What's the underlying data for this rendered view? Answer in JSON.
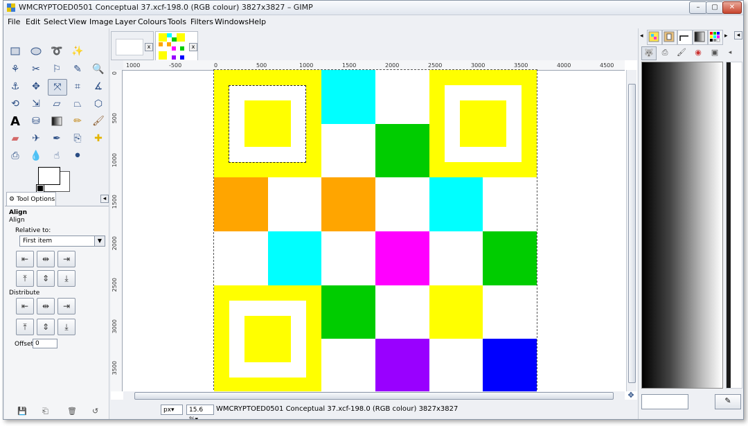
{
  "window": {
    "title": "WMCRYPTOED0501 Conceptual 37.xcf-198.0 (RGB colour) 3827x3827 – GIMP",
    "min_label": "–",
    "max_label": "▢",
    "close_label": "✕"
  },
  "menubar": {
    "items": [
      {
        "label": "File",
        "mnemonic": "F"
      },
      {
        "label": "Edit",
        "mnemonic": "E"
      },
      {
        "label": "Select",
        "mnemonic": "S"
      },
      {
        "label": "View",
        "mnemonic": "V"
      },
      {
        "label": "Image",
        "mnemonic": "I"
      },
      {
        "label": "Layer",
        "mnemonic": "L"
      },
      {
        "label": "Colours",
        "mnemonic": "C"
      },
      {
        "label": "Tools",
        "mnemonic": "T"
      },
      {
        "label": "Filters",
        "mnemonic": "r"
      },
      {
        "label": "Windows",
        "mnemonic": "W"
      },
      {
        "label": "Help",
        "mnemonic": "H"
      }
    ]
  },
  "toolbox": {
    "tools": [
      "rect-select",
      "ellipse-select",
      "free-select",
      "fuzzy-select",
      "by-color-select",
      "scissors-select",
      "foreground-select",
      "paths",
      "color-picker",
      "zoom",
      "measure",
      "move",
      "align",
      "crop",
      "rotate",
      "scale",
      "shear",
      "perspective",
      "flip",
      "cage-transform",
      "text",
      "bucket-fill",
      "blend",
      "pencil",
      "paintbrush",
      "eraser",
      "airbrush",
      "ink",
      "clone",
      "heal",
      "blur",
      "smudge",
      "dodge-burn"
    ],
    "active_tool": "align",
    "tool_options_tab": "Tool Options",
    "section_title": "Align",
    "section_subtitle": "Align",
    "relative_to_label": "Relative to:",
    "relative_to_value": "First item",
    "distribute_label": "Distribute",
    "offset_label": "Offset:",
    "offset_value": "0"
  },
  "image_tabs": {
    "close_label": "x"
  },
  "rulers": {
    "horizontal": [
      "1000",
      "-500",
      "0",
      "500",
      "1000",
      "1500",
      "2000",
      "2500",
      "3000",
      "3500",
      "4000",
      "4500"
    ],
    "vertical": [
      "0",
      "500",
      "1000",
      "1500",
      "2000",
      "2500",
      "3000",
      "3500"
    ]
  },
  "colors": {
    "yellow": "#ffff00",
    "cyan": "#00ffff",
    "white": "#ffffff",
    "green": "#00cc00",
    "orange": "#ffa500",
    "magenta": "#ff00ff",
    "purple": "#9900ff",
    "blue": "#0000ff"
  },
  "artwork_grid": [
    [
      "finder",
      "finder",
      "cyan",
      "white",
      "finder",
      "finder"
    ],
    [
      "finder",
      "finder",
      "white",
      "green",
      "finder",
      "finder"
    ],
    [
      "orange",
      "white",
      "orange",
      "white",
      "cyan",
      "white"
    ],
    [
      "white",
      "cyan",
      "white",
      "magenta",
      "white",
      "green"
    ],
    [
      "finder",
      "finder",
      "green",
      "white",
      "yellow",
      "white"
    ],
    [
      "finder",
      "finder",
      "white",
      "purple",
      "white",
      "blue"
    ]
  ],
  "statusbar": {
    "unit": "px▾",
    "zoom": "15.6 %▾",
    "text": "WMCRYPTOED0501 Conceptual 37.xcf-198.0 (RGB colour) 3827x3827"
  }
}
